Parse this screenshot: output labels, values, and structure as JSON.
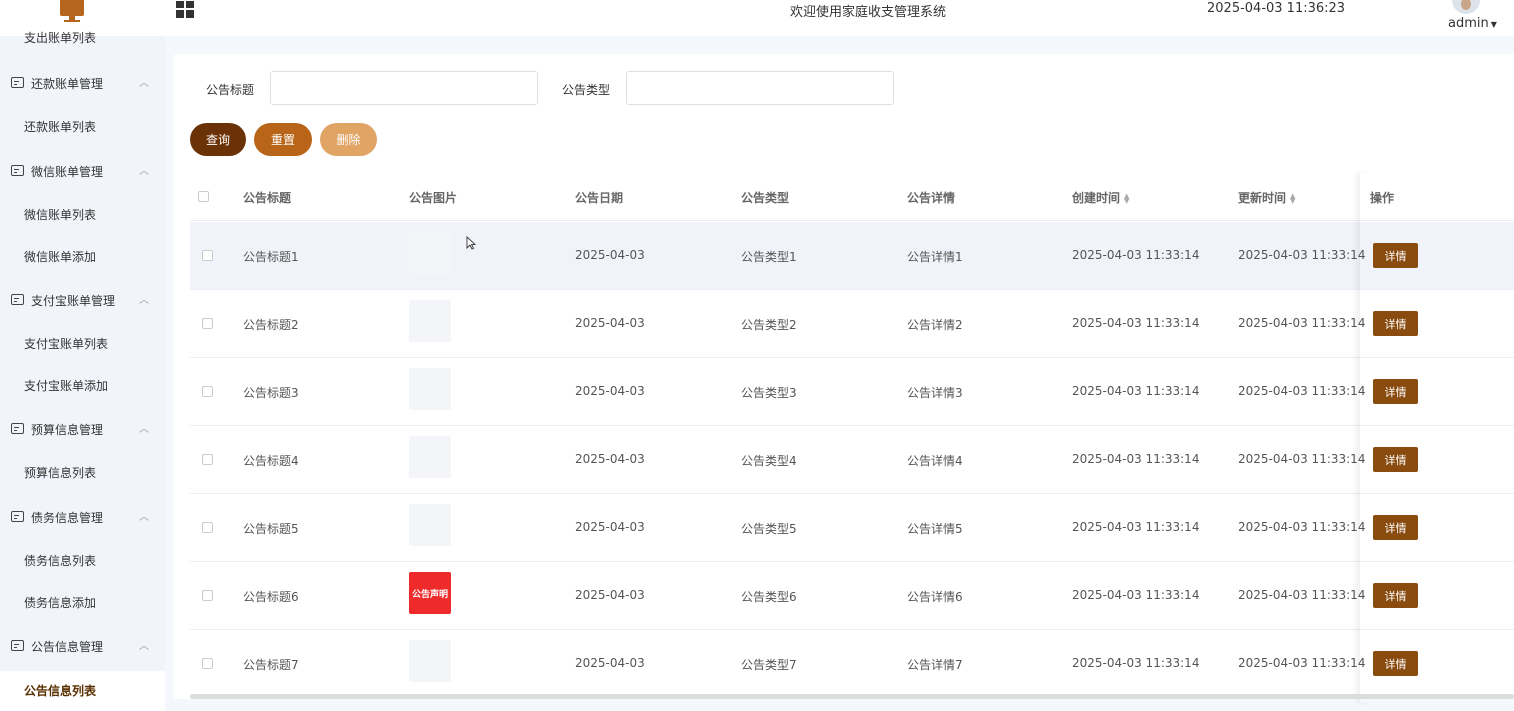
{
  "header": {
    "system_title": "欢迎使用家庭收支管理系统",
    "datetime": "2025-04-03 11:36:23",
    "username": "admin"
  },
  "sidebar": {
    "items": [
      {
        "type": "sub",
        "label": "支出账单列表"
      },
      {
        "type": "group",
        "label": "还款账单管理"
      },
      {
        "type": "sub",
        "label": "还款账单列表"
      },
      {
        "type": "group",
        "label": "微信账单管理"
      },
      {
        "type": "sub",
        "label": "微信账单列表"
      },
      {
        "type": "sub",
        "label": "微信账单添加"
      },
      {
        "type": "group",
        "label": "支付宝账单管理"
      },
      {
        "type": "sub",
        "label": "支付宝账单列表"
      },
      {
        "type": "sub",
        "label": "支付宝账单添加"
      },
      {
        "type": "group",
        "label": "预算信息管理"
      },
      {
        "type": "sub",
        "label": "预算信息列表"
      },
      {
        "type": "group",
        "label": "债务信息管理"
      },
      {
        "type": "sub",
        "label": "债务信息列表"
      },
      {
        "type": "sub",
        "label": "债务信息添加"
      },
      {
        "type": "group",
        "label": "公告信息管理"
      },
      {
        "type": "sub",
        "label": "公告信息列表",
        "active": true
      }
    ]
  },
  "search": {
    "title_label": "公告标题",
    "title_value": "",
    "type_label": "公告类型",
    "type_value": ""
  },
  "buttons": {
    "query": "查询",
    "reset": "重置",
    "delete": "删除"
  },
  "colors": {
    "query_btn": "#6b3207",
    "reset_btn": "#b8651a",
    "delete_btn": "#e0a565",
    "detail_btn": "#8a4b0f"
  },
  "table": {
    "headers": {
      "title": "公告标题",
      "image": "公告图片",
      "date": "公告日期",
      "type": "公告类型",
      "detail": "公告详情",
      "created": "创建时间",
      "updated": "更新时间",
      "action": "操作"
    },
    "detail_label": "详情",
    "rows": [
      {
        "title": "公告标题1",
        "image": "",
        "date": "2025-04-03",
        "type": "公告类型1",
        "detail": "公告详情1",
        "created": "2025-04-03 11:33:14",
        "updated": "2025-04-03 11:33:14"
      },
      {
        "title": "公告标题2",
        "image": "",
        "date": "2025-04-03",
        "type": "公告类型2",
        "detail": "公告详情2",
        "created": "2025-04-03 11:33:14",
        "updated": "2025-04-03 11:33:14"
      },
      {
        "title": "公告标题3",
        "image": "",
        "date": "2025-04-03",
        "type": "公告类型3",
        "detail": "公告详情3",
        "created": "2025-04-03 11:33:14",
        "updated": "2025-04-03 11:33:14"
      },
      {
        "title": "公告标题4",
        "image": "",
        "date": "2025-04-03",
        "type": "公告类型4",
        "detail": "公告详情4",
        "created": "2025-04-03 11:33:14",
        "updated": "2025-04-03 11:33:14"
      },
      {
        "title": "公告标题5",
        "image": "",
        "date": "2025-04-03",
        "type": "公告类型5",
        "detail": "公告详情5",
        "created": "2025-04-03 11:33:14",
        "updated": "2025-04-03 11:33:14"
      },
      {
        "title": "公告标题6",
        "image": "公告声明",
        "date": "2025-04-03",
        "type": "公告类型6",
        "detail": "公告详情6",
        "created": "2025-04-03 11:33:14",
        "updated": "2025-04-03 11:33:14"
      },
      {
        "title": "公告标题7",
        "image": "",
        "date": "2025-04-03",
        "type": "公告类型7",
        "detail": "公告详情7",
        "created": "2025-04-03 11:33:14",
        "updated": "2025-04-03 11:33:14"
      }
    ]
  }
}
